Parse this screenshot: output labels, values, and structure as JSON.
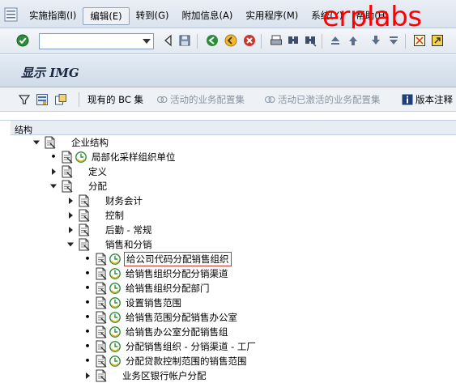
{
  "menu": {
    "items": [
      {
        "name": "menu-implementation-guide",
        "label": "实施指南(I)"
      },
      {
        "name": "menu-edit",
        "label": "编辑(E)",
        "active": true
      },
      {
        "name": "menu-goto",
        "label": "转到(G)"
      },
      {
        "name": "menu-additional-info",
        "label": "附加信息(A)"
      },
      {
        "name": "menu-utilities",
        "label": "实用程序(M)"
      },
      {
        "name": "menu-system",
        "label": "系统(Y)"
      },
      {
        "name": "menu-help",
        "label": "帮助(H)"
      }
    ]
  },
  "watermark": "erplabs",
  "toolbar": {
    "command_value": "",
    "icons": [
      "enter-icon",
      "command-dropdown-icon",
      "back-nav-icon",
      "save-icon",
      "back-icon",
      "exit-icon",
      "cancel-icon",
      "print-icon",
      "find-icon",
      "find-next-icon",
      "first-page-icon",
      "previous-page-icon",
      "next-page-icon",
      "last-page-icon",
      "create-session-icon",
      "shortcut-icon"
    ]
  },
  "title": "显示 IMG",
  "app_toolbar": {
    "current_bc_set": "现有的 BC 集",
    "active_business_config_set": "活动的业务配置集",
    "deactivated_business_config_set": "活动已激活的业务配置集",
    "release_notes": "版本注释"
  },
  "tree": {
    "header": "结构",
    "rows": [
      {
        "label": "企业结构",
        "indent": 0,
        "state": "expanded",
        "exe": false
      },
      {
        "label": "局部化采样组织单位",
        "indent": 1,
        "state": "leaf",
        "exe": true
      },
      {
        "label": "定义",
        "indent": 1,
        "state": "collapsed",
        "exe": false
      },
      {
        "label": "分配",
        "indent": 1,
        "state": "expanded",
        "exe": false
      },
      {
        "label": "财务会计",
        "indent": 2,
        "state": "collapsed",
        "exe": false
      },
      {
        "label": "控制",
        "indent": 2,
        "state": "collapsed",
        "exe": false
      },
      {
        "label": "后勤 - 常规",
        "indent": 2,
        "state": "collapsed",
        "exe": false
      },
      {
        "label": "销售和分销",
        "indent": 2,
        "state": "expanded",
        "exe": false
      },
      {
        "label": "给公司代码分配销售组织",
        "indent": 3,
        "state": "leaf",
        "exe": true,
        "selected": true
      },
      {
        "label": "给销售组织分配分销渠道",
        "indent": 3,
        "state": "leaf",
        "exe": true
      },
      {
        "label": "给销售组织分配部门",
        "indent": 3,
        "state": "leaf",
        "exe": true
      },
      {
        "label": "设置销售范围",
        "indent": 3,
        "state": "leaf",
        "exe": true
      },
      {
        "label": "给销售范围分配销售办公室",
        "indent": 3,
        "state": "leaf",
        "exe": true
      },
      {
        "label": "给销售办公室分配销售组",
        "indent": 3,
        "state": "leaf",
        "exe": true
      },
      {
        "label": "分配销售组织 - 分销渠道 - 工厂",
        "indent": 3,
        "state": "leaf",
        "exe": true
      },
      {
        "label": "分配贷款控制范围的销售范围",
        "indent": 3,
        "state": "leaf",
        "exe": true
      },
      {
        "label": "业务区银行帐户分配",
        "indent": 3,
        "state": "collapsed",
        "exe": false
      }
    ]
  }
}
